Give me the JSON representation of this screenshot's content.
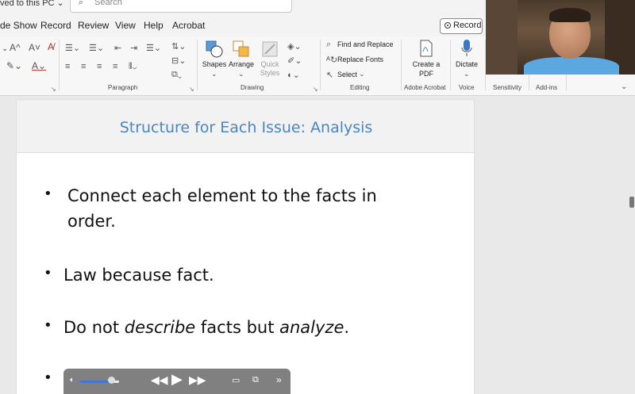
{
  "titlebar": {
    "saved_status": "ved to this PC ⌄",
    "search_placeholder": "Search"
  },
  "tabs": [
    "de Show",
    "Record",
    "Review",
    "View",
    "Help",
    "Acrobat"
  ],
  "record_button": "Record",
  "ribbon": {
    "groups": {
      "paragraph": "Paragraph",
      "drawing": "Drawing",
      "editing": "Editing",
      "adobe": "Adobe Acrobat",
      "voice": "Voice",
      "sensitivity": "Sensitivity",
      "addins": "Add-ins"
    },
    "drawing_buttons": {
      "shapes": "Shapes",
      "arrange": "Arrange",
      "quick_styles": "Quick Styles"
    },
    "editing_buttons": {
      "find_replace": "Find and Replace",
      "replace_fonts": "Replace Fonts",
      "select": "Select"
    },
    "adobe_button": "Create a PDF",
    "dictate_button": "Dictate"
  },
  "slide": {
    "title": "Structure for Each Issue: Analysis",
    "bullets": [
      {
        "line1": "Connect each element to the facts in",
        "line2": "order."
      },
      {
        "text": "Law because fact."
      },
      {
        "pre": "Do not ",
        "em1": "describe",
        "mid": " facts but ",
        "em2": "analyze",
        "post": "."
      },
      {
        "text": ""
      }
    ]
  },
  "media_player": {
    "volume_level": 0.8,
    "icons": [
      "speaker-icon",
      "rewind-icon",
      "play-icon",
      "fast-forward-icon",
      "screen-icon",
      "pip-icon",
      "more-icon"
    ]
  }
}
